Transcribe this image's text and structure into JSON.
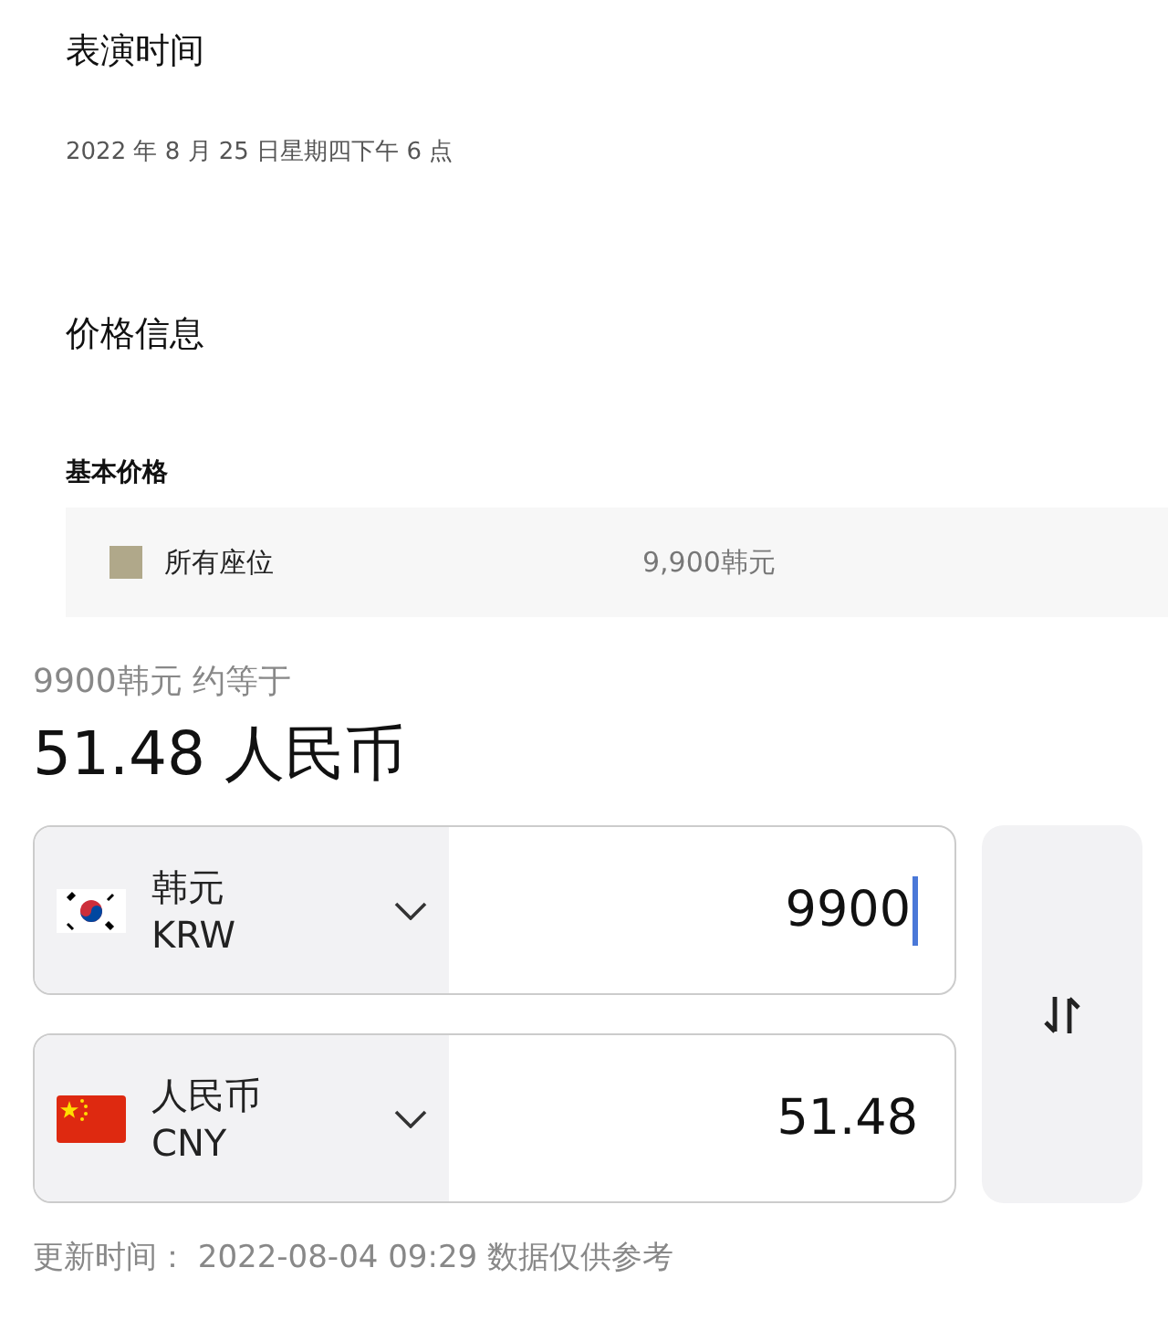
{
  "performance": {
    "heading": "表演时间",
    "datetime": "2022 年 8 月 25 日星期四下午 6 点"
  },
  "price_info": {
    "heading": "价格信息",
    "subheading": "基本价格",
    "rows": [
      {
        "color": "#b0a88a",
        "seat": "所有座位",
        "price": "9,900韩元"
      }
    ]
  },
  "converter": {
    "summary": "9900韩元 约等于",
    "result": "51.48 人民币",
    "currencies": [
      {
        "kind": "kr",
        "name": "韩元",
        "code": "KRW",
        "amount": "9900",
        "focused": true
      },
      {
        "kind": "cn",
        "name": "人民币",
        "code": "CNY",
        "amount": "51.48",
        "focused": false
      }
    ],
    "update_note": "更新时间： 2022-08-04 09:29 数据仅供参考"
  }
}
